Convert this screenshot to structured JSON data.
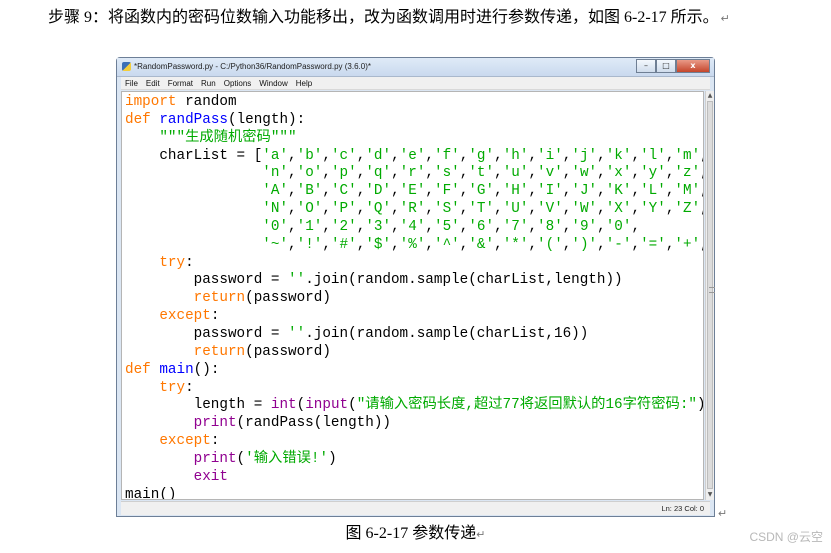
{
  "paragraph": {
    "text": "步骤 9：将函数内的密码位数输入功能移出，改为函数调用时进行参数传递，如图 6-2-17 所示。",
    "mark": "↵"
  },
  "window": {
    "title": "*RandomPassword.py - C:/Python36/RandomPassword.py (3.6.0)*",
    "buttons": {
      "minimize": "–",
      "maximize": "□",
      "close": "x"
    },
    "menu": [
      "File",
      "Edit",
      "Format",
      "Run",
      "Options",
      "Window",
      "Help"
    ],
    "status": "Ln: 23   Col: 0"
  },
  "code_lines": [
    [
      {
        "t": "import",
        "c": "kw"
      },
      {
        "t": " random"
      }
    ],
    [
      {
        "t": "def",
        "c": "kw"
      },
      {
        "t": " "
      },
      {
        "t": "randPass",
        "c": "fn"
      },
      {
        "t": "(length):"
      }
    ],
    [
      {
        "t": "    "
      },
      {
        "t": "\"\"\"生成随机密码\"\"\"",
        "c": "str"
      }
    ],
    [
      {
        "t": "    charList = ["
      },
      {
        "t": "'a'",
        "c": "str"
      },
      {
        "t": ","
      },
      {
        "t": "'b'",
        "c": "str"
      },
      {
        "t": ","
      },
      {
        "t": "'c'",
        "c": "str"
      },
      {
        "t": ","
      },
      {
        "t": "'d'",
        "c": "str"
      },
      {
        "t": ","
      },
      {
        "t": "'e'",
        "c": "str"
      },
      {
        "t": ","
      },
      {
        "t": "'f'",
        "c": "str"
      },
      {
        "t": ","
      },
      {
        "t": "'g'",
        "c": "str"
      },
      {
        "t": ","
      },
      {
        "t": "'h'",
        "c": "str"
      },
      {
        "t": ","
      },
      {
        "t": "'i'",
        "c": "str"
      },
      {
        "t": ","
      },
      {
        "t": "'j'",
        "c": "str"
      },
      {
        "t": ","
      },
      {
        "t": "'k'",
        "c": "str"
      },
      {
        "t": ","
      },
      {
        "t": "'l'",
        "c": "str"
      },
      {
        "t": ","
      },
      {
        "t": "'m'",
        "c": "str"
      },
      {
        "t": ","
      }
    ],
    [
      {
        "t": "                "
      },
      {
        "t": "'n'",
        "c": "str"
      },
      {
        "t": ","
      },
      {
        "t": "'o'",
        "c": "str"
      },
      {
        "t": ","
      },
      {
        "t": "'p'",
        "c": "str"
      },
      {
        "t": ","
      },
      {
        "t": "'q'",
        "c": "str"
      },
      {
        "t": ","
      },
      {
        "t": "'r'",
        "c": "str"
      },
      {
        "t": ","
      },
      {
        "t": "'s'",
        "c": "str"
      },
      {
        "t": ","
      },
      {
        "t": "'t'",
        "c": "str"
      },
      {
        "t": ","
      },
      {
        "t": "'u'",
        "c": "str"
      },
      {
        "t": ","
      },
      {
        "t": "'v'",
        "c": "str"
      },
      {
        "t": ","
      },
      {
        "t": "'w'",
        "c": "str"
      },
      {
        "t": ","
      },
      {
        "t": "'x'",
        "c": "str"
      },
      {
        "t": ","
      },
      {
        "t": "'y'",
        "c": "str"
      },
      {
        "t": ","
      },
      {
        "t": "'z'",
        "c": "str"
      },
      {
        "t": ","
      }
    ],
    [
      {
        "t": "                "
      },
      {
        "t": "'A'",
        "c": "str"
      },
      {
        "t": ","
      },
      {
        "t": "'B'",
        "c": "str"
      },
      {
        "t": ","
      },
      {
        "t": "'C'",
        "c": "str"
      },
      {
        "t": ","
      },
      {
        "t": "'D'",
        "c": "str"
      },
      {
        "t": ","
      },
      {
        "t": "'E'",
        "c": "str"
      },
      {
        "t": ","
      },
      {
        "t": "'F'",
        "c": "str"
      },
      {
        "t": ","
      },
      {
        "t": "'G'",
        "c": "str"
      },
      {
        "t": ","
      },
      {
        "t": "'H'",
        "c": "str"
      },
      {
        "t": ","
      },
      {
        "t": "'I'",
        "c": "str"
      },
      {
        "t": ","
      },
      {
        "t": "'J'",
        "c": "str"
      },
      {
        "t": ","
      },
      {
        "t": "'K'",
        "c": "str"
      },
      {
        "t": ","
      },
      {
        "t": "'L'",
        "c": "str"
      },
      {
        "t": ","
      },
      {
        "t": "'M'",
        "c": "str"
      },
      {
        "t": ","
      }
    ],
    [
      {
        "t": "                "
      },
      {
        "t": "'N'",
        "c": "str"
      },
      {
        "t": ","
      },
      {
        "t": "'O'",
        "c": "str"
      },
      {
        "t": ","
      },
      {
        "t": "'P'",
        "c": "str"
      },
      {
        "t": ","
      },
      {
        "t": "'Q'",
        "c": "str"
      },
      {
        "t": ","
      },
      {
        "t": "'R'",
        "c": "str"
      },
      {
        "t": ","
      },
      {
        "t": "'S'",
        "c": "str"
      },
      {
        "t": ","
      },
      {
        "t": "'T'",
        "c": "str"
      },
      {
        "t": ","
      },
      {
        "t": "'U'",
        "c": "str"
      },
      {
        "t": ","
      },
      {
        "t": "'V'",
        "c": "str"
      },
      {
        "t": ","
      },
      {
        "t": "'W'",
        "c": "str"
      },
      {
        "t": ","
      },
      {
        "t": "'X'",
        "c": "str"
      },
      {
        "t": ","
      },
      {
        "t": "'Y'",
        "c": "str"
      },
      {
        "t": ","
      },
      {
        "t": "'Z'",
        "c": "str"
      },
      {
        "t": ","
      }
    ],
    [
      {
        "t": "                "
      },
      {
        "t": "'0'",
        "c": "str"
      },
      {
        "t": ","
      },
      {
        "t": "'1'",
        "c": "str"
      },
      {
        "t": ","
      },
      {
        "t": "'2'",
        "c": "str"
      },
      {
        "t": ","
      },
      {
        "t": "'3'",
        "c": "str"
      },
      {
        "t": ","
      },
      {
        "t": "'4'",
        "c": "str"
      },
      {
        "t": ","
      },
      {
        "t": "'5'",
        "c": "str"
      },
      {
        "t": ","
      },
      {
        "t": "'6'",
        "c": "str"
      },
      {
        "t": ","
      },
      {
        "t": "'7'",
        "c": "str"
      },
      {
        "t": ","
      },
      {
        "t": "'8'",
        "c": "str"
      },
      {
        "t": ","
      },
      {
        "t": "'9'",
        "c": "str"
      },
      {
        "t": ","
      },
      {
        "t": "'0'",
        "c": "str"
      },
      {
        "t": ","
      }
    ],
    [
      {
        "t": "                "
      },
      {
        "t": "'~'",
        "c": "str"
      },
      {
        "t": ","
      },
      {
        "t": "'!'",
        "c": "str"
      },
      {
        "t": ","
      },
      {
        "t": "'#'",
        "c": "str"
      },
      {
        "t": ","
      },
      {
        "t": "'$'",
        "c": "str"
      },
      {
        "t": ","
      },
      {
        "t": "'%'",
        "c": "str"
      },
      {
        "t": ","
      },
      {
        "t": "'^'",
        "c": "str"
      },
      {
        "t": ","
      },
      {
        "t": "'&'",
        "c": "str"
      },
      {
        "t": ","
      },
      {
        "t": "'*'",
        "c": "str"
      },
      {
        "t": ","
      },
      {
        "t": "'('",
        "c": "str"
      },
      {
        "t": ","
      },
      {
        "t": "')'",
        "c": "str"
      },
      {
        "t": ","
      },
      {
        "t": "'-'",
        "c": "str"
      },
      {
        "t": ","
      },
      {
        "t": "'='",
        "c": "str"
      },
      {
        "t": ","
      },
      {
        "t": "'+'",
        "c": "str"
      },
      {
        "t": ","
      },
      {
        "t": "'_'",
        "c": "str"
      },
      {
        "t": "]"
      }
    ],
    [
      {
        "t": "    "
      },
      {
        "t": "try",
        "c": "kw"
      },
      {
        "t": ":"
      }
    ],
    [
      {
        "t": "        password = "
      },
      {
        "t": "''",
        "c": "str"
      },
      {
        "t": ".join(random.sample(charList,length))"
      }
    ],
    [
      {
        "t": "        "
      },
      {
        "t": "return",
        "c": "kw"
      },
      {
        "t": "(password)"
      }
    ],
    [
      {
        "t": "    "
      },
      {
        "t": "except",
        "c": "kw"
      },
      {
        "t": ":"
      }
    ],
    [
      {
        "t": "        password = "
      },
      {
        "t": "''",
        "c": "str"
      },
      {
        "t": ".join(random.sample(charList,16))"
      }
    ],
    [
      {
        "t": "        "
      },
      {
        "t": "return",
        "c": "kw"
      },
      {
        "t": "(password)"
      }
    ],
    [
      {
        "t": "def",
        "c": "kw"
      },
      {
        "t": " "
      },
      {
        "t": "main",
        "c": "fn"
      },
      {
        "t": "():"
      }
    ],
    [
      {
        "t": "    "
      },
      {
        "t": "try",
        "c": "kw"
      },
      {
        "t": ":"
      }
    ],
    [
      {
        "t": "        length = "
      },
      {
        "t": "int",
        "c": "bi"
      },
      {
        "t": "("
      },
      {
        "t": "input",
        "c": "bi"
      },
      {
        "t": "("
      },
      {
        "t": "\"请输入密码长度,超过77将返回默认的16字符密码:\"",
        "c": "str"
      },
      {
        "t": "))"
      }
    ],
    [
      {
        "t": "        "
      },
      {
        "t": "print",
        "c": "bi"
      },
      {
        "t": "(randPass(length))"
      }
    ],
    [
      {
        "t": "    "
      },
      {
        "t": "except",
        "c": "kw"
      },
      {
        "t": ":"
      }
    ],
    [
      {
        "t": "        "
      },
      {
        "t": "print",
        "c": "bi"
      },
      {
        "t": "("
      },
      {
        "t": "'输入错误!'",
        "c": "str"
      },
      {
        "t": ")"
      }
    ],
    [
      {
        "t": "        "
      },
      {
        "t": "exit",
        "c": "bi"
      }
    ],
    [
      {
        "t": "main()"
      }
    ]
  ],
  "caption": {
    "text": "图 6-2-17  参数传递",
    "mark": "↵"
  },
  "watermark": "CSDN @云空",
  "colors": {
    "keyword": "#ff7700",
    "definition": "#0000ff",
    "string": "#00aa00",
    "builtin": "#900090"
  }
}
